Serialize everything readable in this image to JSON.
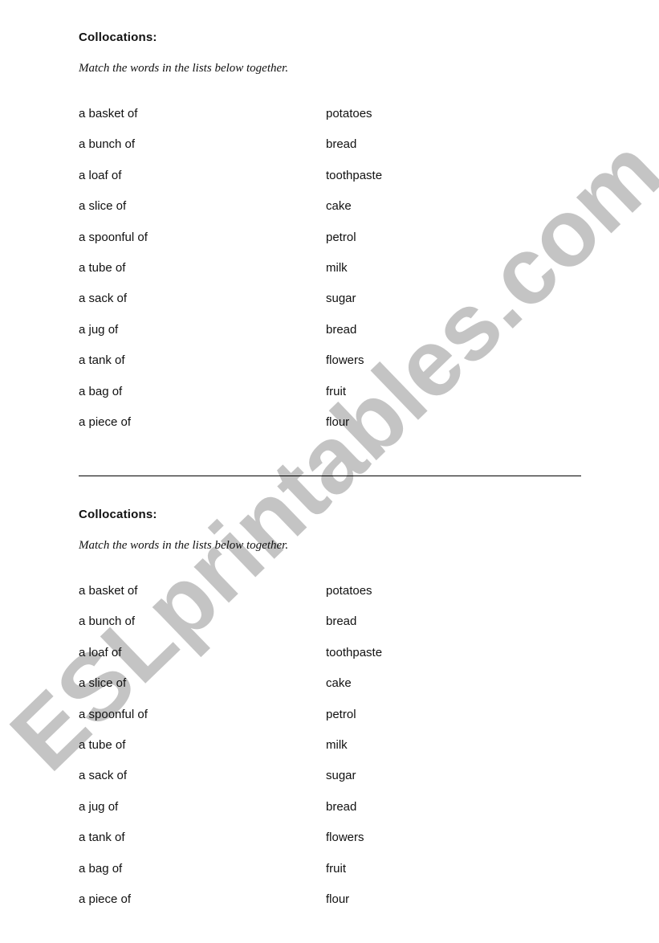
{
  "worksheets": [
    {
      "title": "Collocations:",
      "instruction": "Match the words in the lists below together.",
      "left_column": [
        "a basket of",
        "a bunch of",
        "a loaf of",
        "a slice of",
        "a spoonful of",
        "a tube of",
        "a sack of",
        "a jug of",
        "a tank of",
        "a bag of",
        "a piece of"
      ],
      "right_column": [
        "potatoes",
        "bread",
        "toothpaste",
        "cake",
        "petrol",
        "milk",
        "sugar",
        "bread",
        "flowers",
        "fruit",
        "flour"
      ]
    },
    {
      "title": "Collocations:",
      "instruction": "Match the words in the lists below together.",
      "left_column": [
        "a basket of",
        "a bunch of",
        "a loaf of",
        "a slice of",
        "a spoonful of",
        "a tube of",
        "a sack of",
        "a jug of",
        "a tank of",
        "a bag of",
        "a piece of"
      ],
      "right_column": [
        "potatoes",
        "bread",
        "toothpaste",
        "cake",
        "petrol",
        "milk",
        "sugar",
        "bread",
        "flowers",
        "fruit",
        "flour"
      ]
    }
  ],
  "watermark": {
    "text": "ESLprintables.com",
    "color": "#c4c4c4"
  }
}
